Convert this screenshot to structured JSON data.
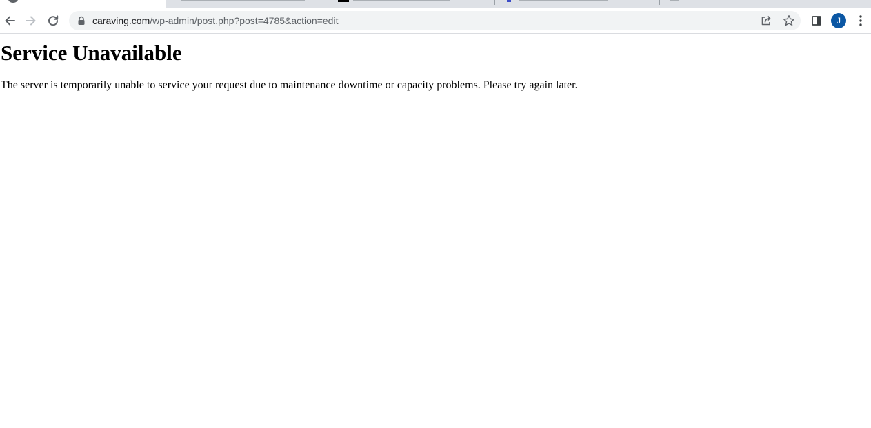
{
  "browser": {
    "url": {
      "host": "caraving.com",
      "path": "/wp-admin/post.php?post=4785&action=edit"
    },
    "profile_initial": "J",
    "icons": {
      "back": "back-arrow-icon",
      "forward": "forward-arrow-icon",
      "reload": "reload-icon",
      "lock": "lock-icon",
      "share": "share-icon",
      "bookmark": "star-icon",
      "side_panel": "side-panel-icon",
      "menu": "kebab-menu-icon"
    },
    "colors": {
      "avatar": "#0b57a4",
      "omnibox": "#f1f3f4",
      "tabstrip": "#dee1e6"
    }
  },
  "page": {
    "heading": "Service Unavailable",
    "message": "The server is temporarily unable to service your request due to maintenance downtime or capacity problems. Please try again later."
  }
}
